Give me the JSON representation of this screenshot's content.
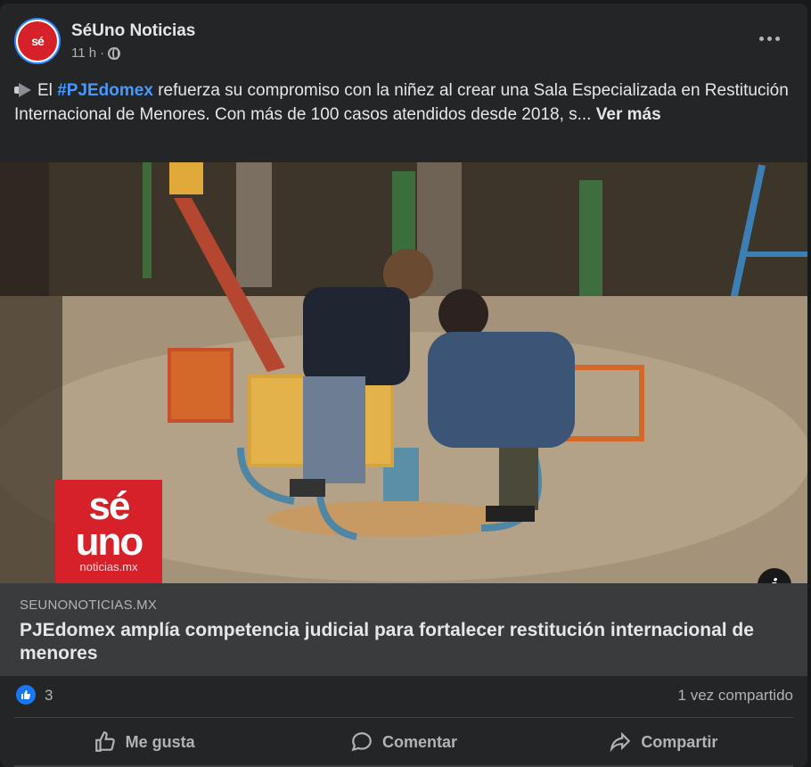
{
  "post": {
    "page_name": "SéUno Noticias",
    "time": "11 h",
    "separator": "·",
    "text_intro": "El ",
    "hashtag": "#PJEdomex",
    "text_body": " refuerza su compromiso con la niñez al crear una Sala Especializada en Restitución Internacional de Menores. Con más de 100 casos atendidos desde 2018, s...",
    "see_more": "Ver más"
  },
  "image": {
    "logo_line1": "sé",
    "logo_line2": "uno",
    "logo_line3": "noticias.mx"
  },
  "link": {
    "domain": "SEUNONOTICIAS.MX",
    "title": "PJEdomex amplía competencia judicial para fortalecer restitución internacional de menores"
  },
  "engagement": {
    "reaction_count": "3",
    "shares": "1 vez compartido"
  },
  "actions": {
    "like": "Me gusta",
    "comment": "Comentar",
    "share": "Compartir"
  },
  "colors": {
    "background": "#242526",
    "hashtag": "#4599ff",
    "like_badge": "#1877f2",
    "brand_red": "#d6202a"
  }
}
